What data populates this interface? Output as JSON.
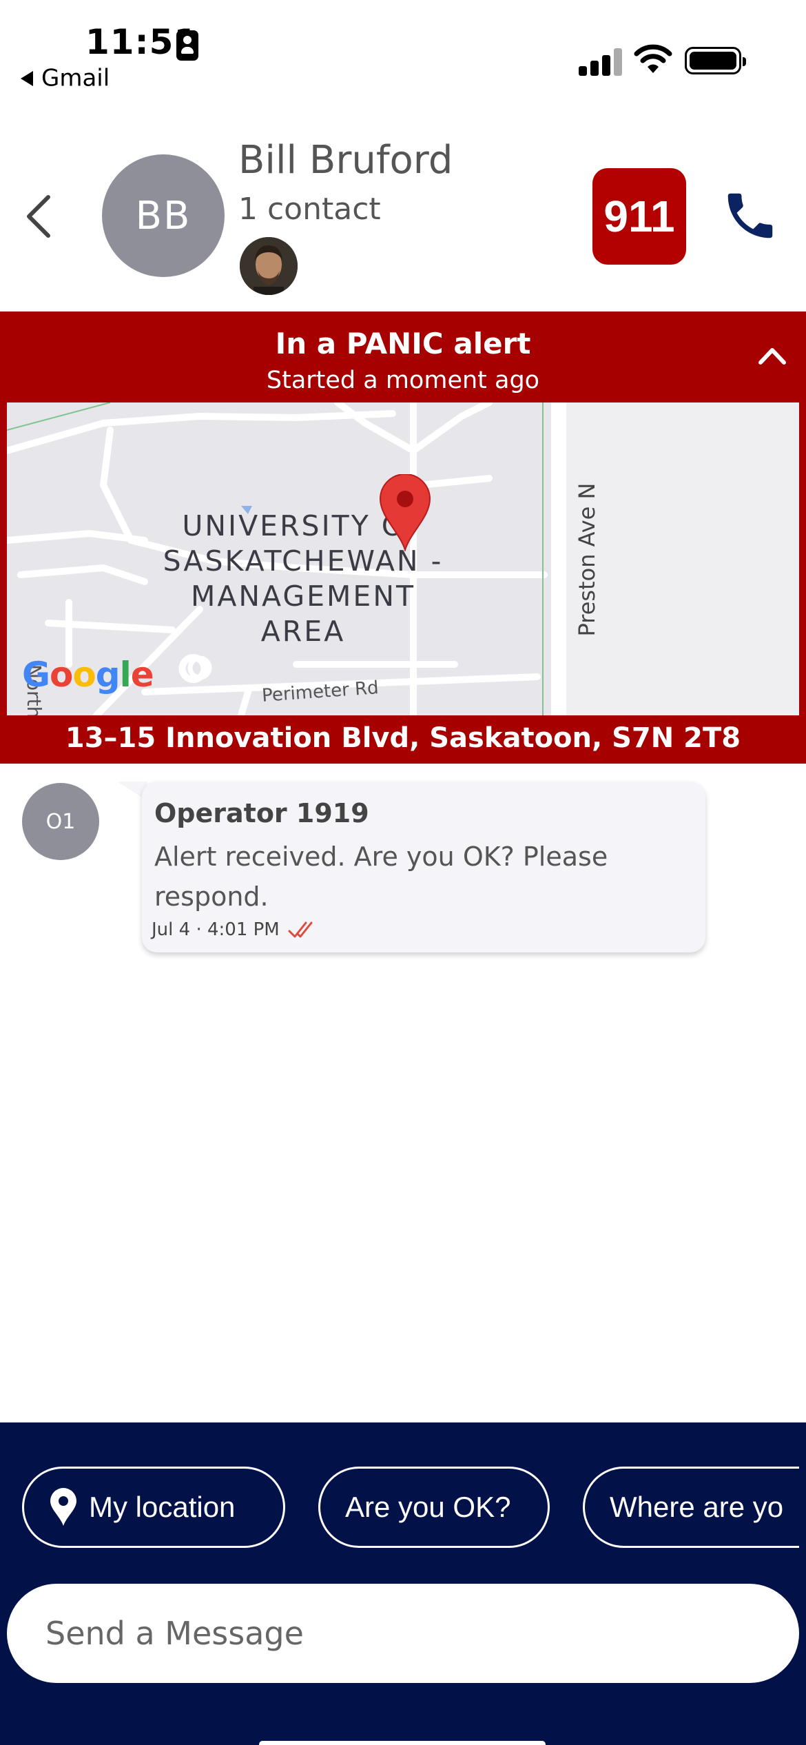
{
  "status_bar": {
    "time": "11:51",
    "back_app": "Gmail"
  },
  "header": {
    "avatar_initials": "BB",
    "name": "Bill Bruford",
    "contact_count": "1 contact",
    "emergency_label": "911",
    "accent_color": "#b30000",
    "call_icon_color": "#0b2461"
  },
  "alert": {
    "title": "In a PANIC alert",
    "subtitle": "Started a moment ago",
    "color": "#a60000"
  },
  "map": {
    "area_label": "UNIVERSITY OF SASKATCHEWAN - MANAGEMENT AREA",
    "street_label": "Preston Ave N",
    "road_label": "Perimeter Rd",
    "side_road_label": "North R",
    "attribution": "Google"
  },
  "address": "13–15 Innovation Blvd, Saskatoon, S7N 2T8",
  "messages": [
    {
      "avatar": "O1",
      "sender": "Operator 1919",
      "text": "Alert received. Are you OK? Please respond.",
      "timestamp": "Jul 4 · 4:01 PM",
      "status_icon": "double-check-icon"
    }
  ],
  "quick_replies": {
    "my_location": "My location",
    "are_you_ok": "Are you OK?",
    "where_are_you": "Where are yo"
  },
  "composer": {
    "placeholder": "Send a Message"
  },
  "panel_color": "#021248"
}
